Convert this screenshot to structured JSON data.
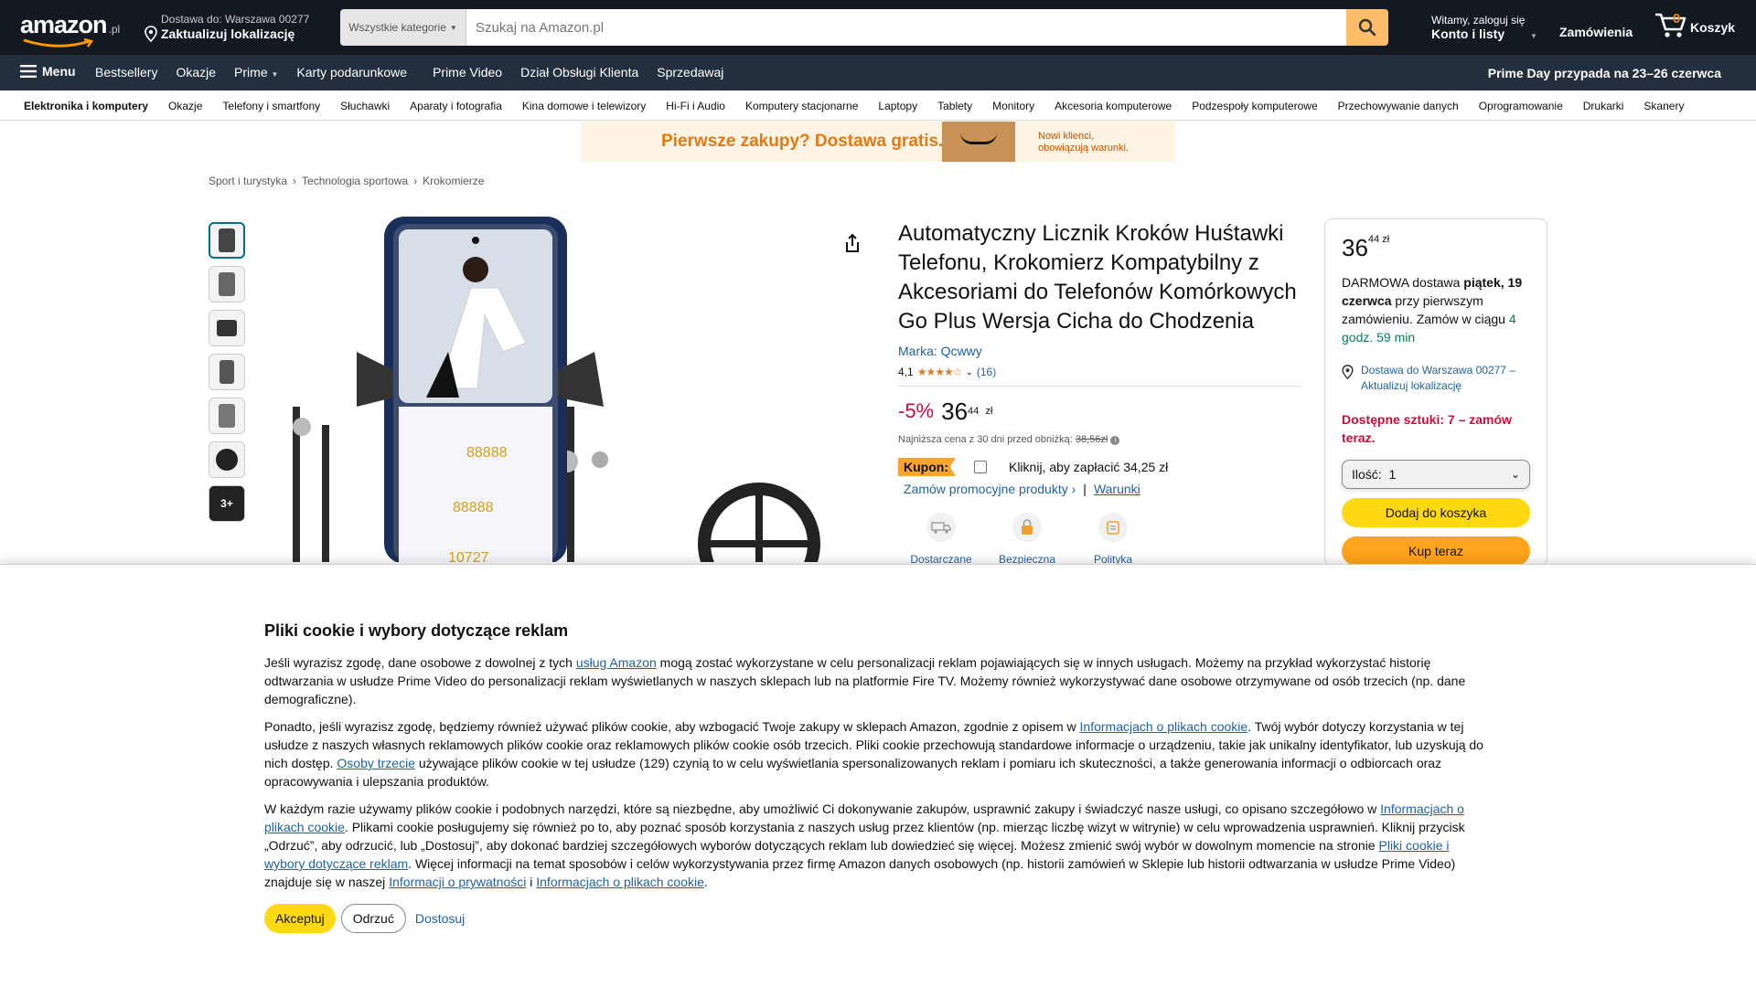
{
  "header": {
    "logo_text": "amazon",
    "logo_tld": ".pl",
    "deliver_line1": "Dostawa do: Warszawa 00277",
    "deliver_line2": "Zaktualizuj lokalizację",
    "search_category": "Wszystkie kategorie",
    "search_placeholder": "Szukaj na Amazon.pl",
    "account_line1": "Witamy, zaloguj się",
    "account_line2": "Konto i listy",
    "orders": "Zamówienia",
    "cart_count": "0",
    "cart_label": "Koszyk"
  },
  "subnav": {
    "menu": "Menu",
    "items": [
      "Bestsellery",
      "Okazje",
      "Prime",
      "Karty podarunkowe",
      "Prime Video",
      "Dział Obsługi Klienta",
      "Sprzedawaj"
    ],
    "promo": "Prime Day przypada na 23–26 czerwca"
  },
  "categories": [
    "Elektronika i komputery",
    "Okazje",
    "Telefony i smartfony",
    "Słuchawki",
    "Aparaty i fotografia",
    "Kina domowe i telewizory",
    "Hi-Fi i Audio",
    "Komputery stacjonarne",
    "Laptopy",
    "Tablety",
    "Monitory",
    "Akcesoria komputerowe",
    "Podzespoły komputerowe",
    "Przechowywanie danych",
    "Oprogramowanie",
    "Drukarki",
    "Skanery"
  ],
  "banner": {
    "main": "Pierwsze zakupy? Dostawa gratis.",
    "sub": "Nowi klienci, obowiązują warunki."
  },
  "breadcrumb": [
    "Sport i turystyka",
    "Technologia sportowa",
    "Krokomierze"
  ],
  "thumbnails": {
    "more_label": "3+"
  },
  "product": {
    "title": "Automatyczny Licznik Kroków Huśtawki Telefonu, Krokomierz Kompatybilny z Akcesoriami do Telefonów Komórkowych Go Plus Wersja Cicha do Chodzenia",
    "brand": "Marka: Qcwwy",
    "rating_value": "4,1",
    "rating_count": "(16)",
    "discount": "-5%",
    "price_whole": "36",
    "price_fraction": "44",
    "price_currency": "zł",
    "lowest_label": "Najniższa cena z 30 dni przed obniżką:",
    "lowest_price": "38,56zł",
    "coupon_label": "Kupon:",
    "coupon_text": "Kliknij, aby zapłacić 34,25 zł",
    "promo_link": "Zamów promocyjne produkty ›",
    "promo_sep": "|",
    "terms_link": "Warunki",
    "features": [
      "Dostarczane",
      "Bezpieczna",
      "Polityka zwrotów"
    ]
  },
  "buybox": {
    "price_whole": "36",
    "price_fraction": "44 zł",
    "delivery_prefix": "DARMOWA dostawa ",
    "delivery_date": "piątek, 19 czerwca",
    "delivery_mid": " przy pierwszym zamówieniu. Zamów w ciągu ",
    "delivery_countdown": "4 godz. 59 min",
    "location": "Dostawa do Warszawa 00277 – Aktualizuj lokalizację",
    "stock": "Dostępne sztuki: 7 – zamów teraz.",
    "qty_label": "Ilość:",
    "qty_value": "1",
    "add_to_cart": "Dodaj do koszyka",
    "buy_now": "Kup teraz"
  },
  "cookie": {
    "title": "Pliki cookie i wybory dotyczące reklam",
    "p1_a": "Jeśli wyrazisz zgodę, dane osobowe z dowolnej z tych ",
    "p1_link": "usług Amazon",
    "p1_b": " mogą zostać wykorzystane w celu personalizacji reklam pojawiających się w innych usługach. Możemy na przykład wykorzystać historię odtwarzania w usłudze Prime Video do personalizacji reklam wyświetlanych w naszych sklepach lub na platformie Fire TV. Możemy również wykorzystywać dane osobowe otrzymywane od osób trzecich (np. dane demograficzne).",
    "p2_a": "Ponadto, jeśli wyrazisz zgodę, będziemy również używać plików cookie, aby wzbogacić Twoje zakupy w sklepach Amazon, zgodnie z opisem w ",
    "p2_link1": "Informacjach o plikach cookie",
    "p2_b": ". Twój wybór dotyczy korzystania w tej usłudze z naszych własnych reklamowych plików cookie oraz reklamowych plików cookie osób trzecich. Pliki cookie przechowują standardowe informacje o urządzeniu, takie jak unikalny identyfikator, lub uzyskują do nich dostęp. ",
    "p2_link2": "Osoby trzecie",
    "p2_c": " używające plików cookie w tej usłudze (129) czynią to w celu wyświetlania spersonalizowanych reklam i pomiaru ich skuteczności, a także generowania informacji o odbiorcach oraz opracowywania i ulepszania produktów.",
    "p3_a": "W każdym razie używamy plików cookie i podobnych narzędzi, które są niezbędne, aby umożliwić Ci dokonywanie zakupów, usprawnić zakupy i świadczyć nasze usługi, co opisano szczegółowo w ",
    "p3_link1": "Informacjach o plikach cookie",
    "p3_b": ". Plikami cookie posługujemy się również po to, aby poznać sposób korzystania z naszych usług przez klientów (np. mierząc liczbę wizyt w witrynie) w celu wprowadzenia usprawnień. Kliknij przycisk „Odrzuć”, aby odrzucić, lub „Dostosuj”, aby dokonać bardziej szczegółowych wyborów dotyczących reklam lub dowiedzieć się więcej. Możesz zmienić swój wybór w dowolnym momencie na stronie ",
    "p3_link2": "Pliki cookie i wybory dotyczące reklam",
    "p3_c": ". Więcej informacji na temat sposobów i celów wykorzystywania przez firmę Amazon danych osobowych (np. historii zamówień w Sklepie lub historii odtwarzania w usłudze Prime Video) znajduje się w naszej ",
    "p3_link3": "Informacji o prywatności",
    "p3_d": " i ",
    "p3_link4": "Informacjach o plikach cookie",
    "p3_e": ".",
    "accept": "Akceptuj",
    "reject": "Odrzuć",
    "customize": "Dostosuj"
  },
  "colors": {
    "nav_dark": "#131921",
    "nav_secondary": "#232f3e",
    "accent_orange": "#febd69",
    "button_yellow": "#ffd814",
    "button_orange": "#ffa41c",
    "deal_red": "#cc0c39",
    "link_blue": "#2162a1"
  }
}
